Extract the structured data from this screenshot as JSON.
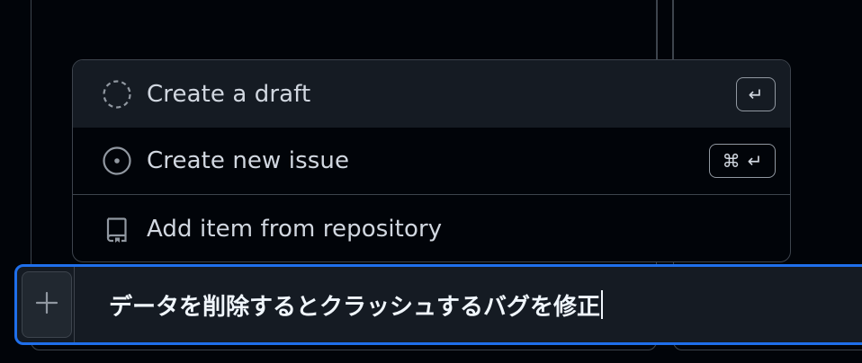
{
  "menu": {
    "items": [
      {
        "label": "Create a draft",
        "icon": "dashed-circle-icon",
        "shortcut": "↵"
      },
      {
        "label": "Create new issue",
        "icon": "issue-opened-icon",
        "shortcut_cmd": "⌘",
        "shortcut": "↵"
      },
      {
        "label": "Add item from repository",
        "icon": "repo-icon"
      }
    ]
  },
  "input": {
    "value": "データを削除するとクラッシュするバグを修正",
    "add_button_icon": "plus-icon"
  },
  "colors": {
    "background": "#010409",
    "menu_active": "#151b23",
    "border": "#3d444d",
    "focus_border": "#1f6feb",
    "text": "#d1d7e0"
  }
}
